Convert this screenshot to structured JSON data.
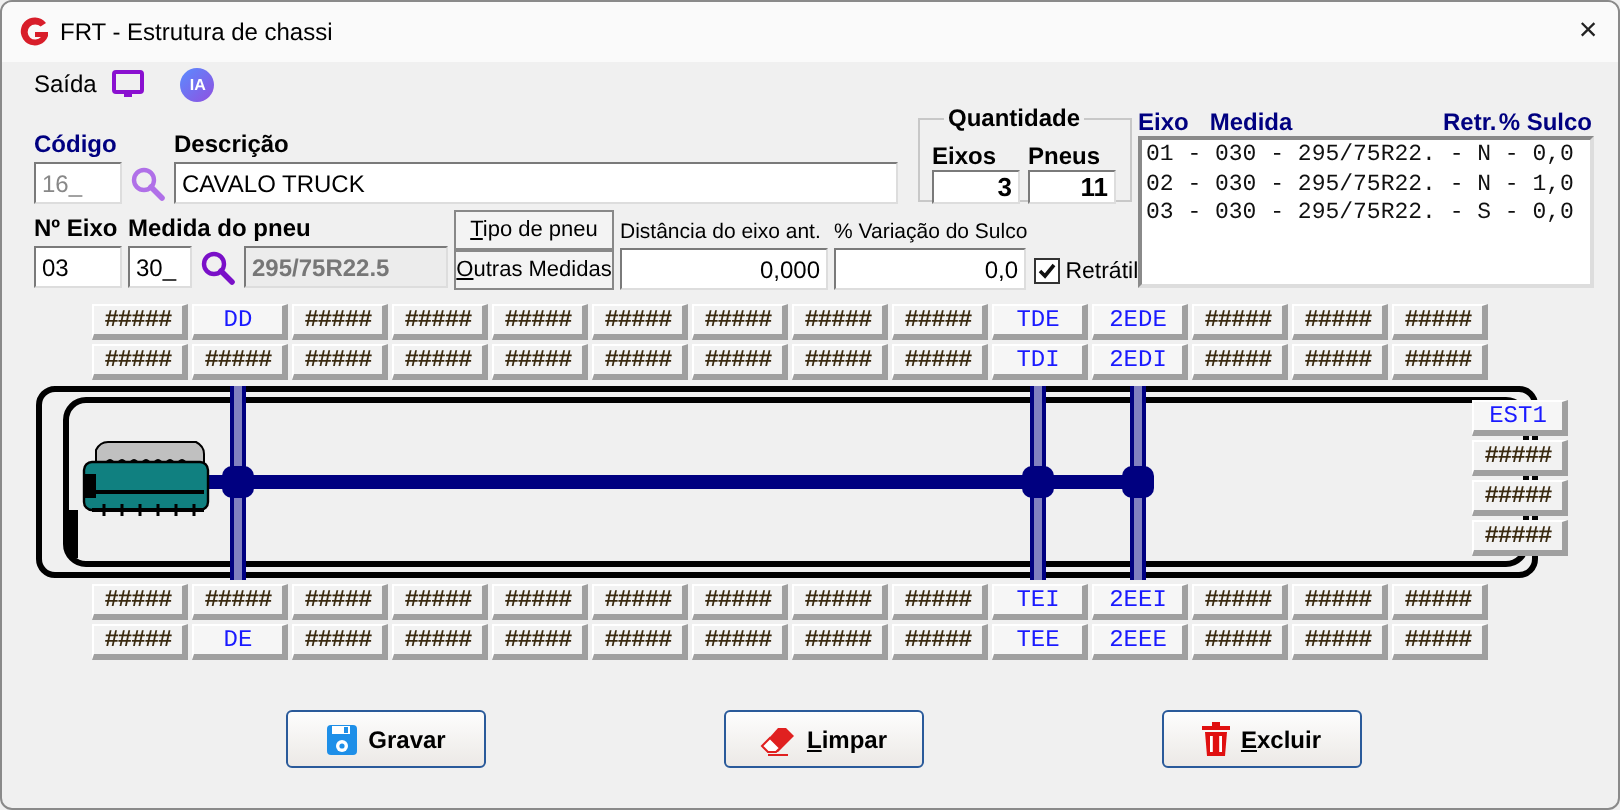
{
  "window": {
    "title": "FRT - Estrutura de chassi",
    "close": "×"
  },
  "menu": {
    "label": "Saída",
    "badge": "IA"
  },
  "form": {
    "codigo": {
      "label": "Código",
      "value": "16_",
      "disabled": true
    },
    "descricao": {
      "label": "Descrição",
      "value": "CAVALO TRUCK"
    },
    "quantidade": {
      "title": "Quantidade",
      "eixos_label": "Eixos",
      "eixos": "3",
      "pneus_label": "Pneus",
      "pneus": "11"
    },
    "n_eixo": {
      "label": "Nº Eixo",
      "value": "03"
    },
    "medida": {
      "label": "Medida do pneu",
      "code": "30_",
      "size": "295/75R22.5"
    },
    "buttons": [
      {
        "label": "Tipo de pneu",
        "mnemonic": true
      },
      {
        "label": "Outras Medidas",
        "mnemonic": true
      }
    ],
    "distancia": {
      "label": "Distância do eixo ant.",
      "value": "0,000"
    },
    "variacao": {
      "label": "% Variação do Sulco",
      "value": "0,0"
    },
    "retratil": {
      "label": "Retrátil",
      "checked": true
    }
  },
  "axle_list": {
    "columns": [
      "Eixo",
      "Medida",
      "Retr.",
      "% Sulco"
    ],
    "rows": [
      "01 - 030 - 295/75R22. - N - 0,0",
      "02 - 030 - 295/75R22. - N - 1,0",
      "03 - 030 - 295/75R22. - S - 0,0"
    ]
  },
  "tire_slots": {
    "rows": [
      [
        {
          "text": "#####",
          "assigned": false
        },
        {
          "text": "DD",
          "assigned": true
        },
        {
          "text": "#####",
          "assigned": false
        },
        {
          "text": "#####",
          "assigned": false
        },
        {
          "text": "#####",
          "assigned": false
        },
        {
          "text": "#####",
          "assigned": false
        },
        {
          "text": "#####",
          "assigned": false
        },
        {
          "text": "#####",
          "assigned": false
        },
        {
          "text": "#####",
          "assigned": false
        },
        {
          "text": "TDE",
          "assigned": true
        },
        {
          "text": "2EDE",
          "assigned": true
        },
        {
          "text": "#####",
          "assigned": false
        },
        {
          "text": "#####",
          "assigned": false
        },
        {
          "text": "#####",
          "assigned": false
        }
      ],
      [
        {
          "text": "#####",
          "assigned": false
        },
        {
          "text": "#####",
          "assigned": false
        },
        {
          "text": "#####",
          "assigned": false
        },
        {
          "text": "#####",
          "assigned": false
        },
        {
          "text": "#####",
          "assigned": false
        },
        {
          "text": "#####",
          "assigned": false
        },
        {
          "text": "#####",
          "assigned": false
        },
        {
          "text": "#####",
          "assigned": false
        },
        {
          "text": "#####",
          "assigned": false
        },
        {
          "text": "TDI",
          "assigned": true
        },
        {
          "text": "2EDI",
          "assigned": true
        },
        {
          "text": "#####",
          "assigned": false
        },
        {
          "text": "#####",
          "assigned": false
        },
        {
          "text": "#####",
          "assigned": false
        }
      ],
      [
        {
          "text": "#####",
          "assigned": false
        },
        {
          "text": "#####",
          "assigned": false
        },
        {
          "text": "#####",
          "assigned": false
        },
        {
          "text": "#####",
          "assigned": false
        },
        {
          "text": "#####",
          "assigned": false
        },
        {
          "text": "#####",
          "assigned": false
        },
        {
          "text": "#####",
          "assigned": false
        },
        {
          "text": "#####",
          "assigned": false
        },
        {
          "text": "#####",
          "assigned": false
        },
        {
          "text": "TEI",
          "assigned": true
        },
        {
          "text": "2EEI",
          "assigned": true
        },
        {
          "text": "#####",
          "assigned": false
        },
        {
          "text": "#####",
          "assigned": false
        },
        {
          "text": "#####",
          "assigned": false
        }
      ],
      [
        {
          "text": "#####",
          "assigned": false
        },
        {
          "text": "DE",
          "assigned": true
        },
        {
          "text": "#####",
          "assigned": false
        },
        {
          "text": "#####",
          "assigned": false
        },
        {
          "text": "#####",
          "assigned": false
        },
        {
          "text": "#####",
          "assigned": false
        },
        {
          "text": "#####",
          "assigned": false
        },
        {
          "text": "#####",
          "assigned": false
        },
        {
          "text": "#####",
          "assigned": false
        },
        {
          "text": "TEE",
          "assigned": true
        },
        {
          "text": "2EEE",
          "assigned": true
        },
        {
          "text": "#####",
          "assigned": false
        },
        {
          "text": "#####",
          "assigned": false
        },
        {
          "text": "#####",
          "assigned": false
        }
      ]
    ],
    "side": [
      {
        "text": "EST1",
        "assigned": true
      },
      {
        "text": "#####",
        "assigned": false
      },
      {
        "text": "#####",
        "assigned": false
      },
      {
        "text": "#####",
        "assigned": false
      }
    ]
  },
  "actions": [
    {
      "kind": "save",
      "label": "Gravar",
      "mnemonic": false
    },
    {
      "kind": "clear",
      "label": "Limpar",
      "mnemonic": true
    },
    {
      "kind": "delete",
      "label": "Excluir",
      "mnemonic": true
    }
  ]
}
